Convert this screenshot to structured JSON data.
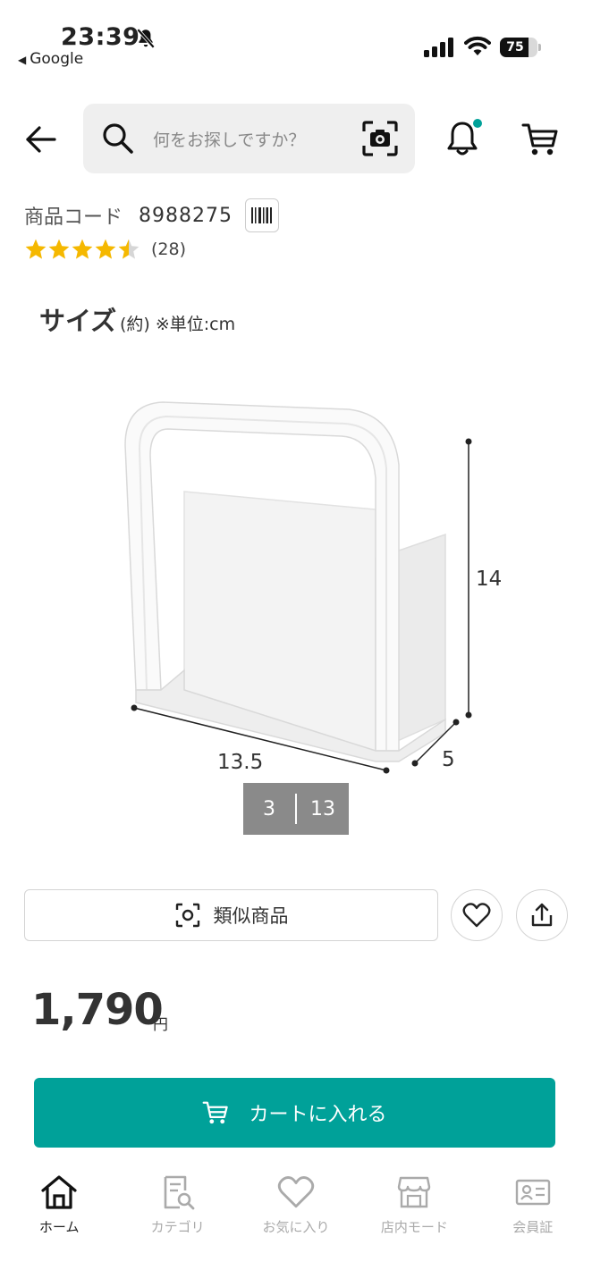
{
  "status_bar": {
    "time": "23:39",
    "back_app": "Google",
    "battery": "75",
    "battery_level": 0.75
  },
  "header": {
    "search_placeholder": "何をお探しですか？",
    "icons": [
      "back-arrow-icon",
      "search-icon",
      "camera-scan-icon",
      "bell-icon",
      "cart-icon"
    ],
    "notification_dot_color": "#00a199"
  },
  "product": {
    "code_label": "商品コード",
    "code_value": "8988275",
    "rating_value": 4.5,
    "rating_max": 5,
    "review_count": "(28)",
    "star_color": "#f5b800"
  },
  "image": {
    "size_title": "サイズ",
    "size_note": "(約) ※単位:cm",
    "dim_width": "13.5",
    "dim_depth": "5",
    "dim_height": "14",
    "page_current": "3",
    "page_total": "13"
  },
  "actions": {
    "similar_label": "類似商品",
    "favorite_icon": "heart-icon",
    "share_icon": "share-icon"
  },
  "price": {
    "amount": "1,790",
    "unit": "円"
  },
  "cart_button": {
    "label": "カートに入れる",
    "color": "#00a199"
  },
  "bottom_nav": {
    "items": [
      {
        "label": "ホーム",
        "icon": "home-icon",
        "active": true
      },
      {
        "label": "カテゴリ",
        "icon": "category-icon",
        "active": false
      },
      {
        "label": "お気に入り",
        "icon": "heart-icon",
        "active": false
      },
      {
        "label": "店内モード",
        "icon": "store-icon",
        "active": false
      },
      {
        "label": "会員証",
        "icon": "member-card-icon",
        "active": false
      }
    ]
  }
}
